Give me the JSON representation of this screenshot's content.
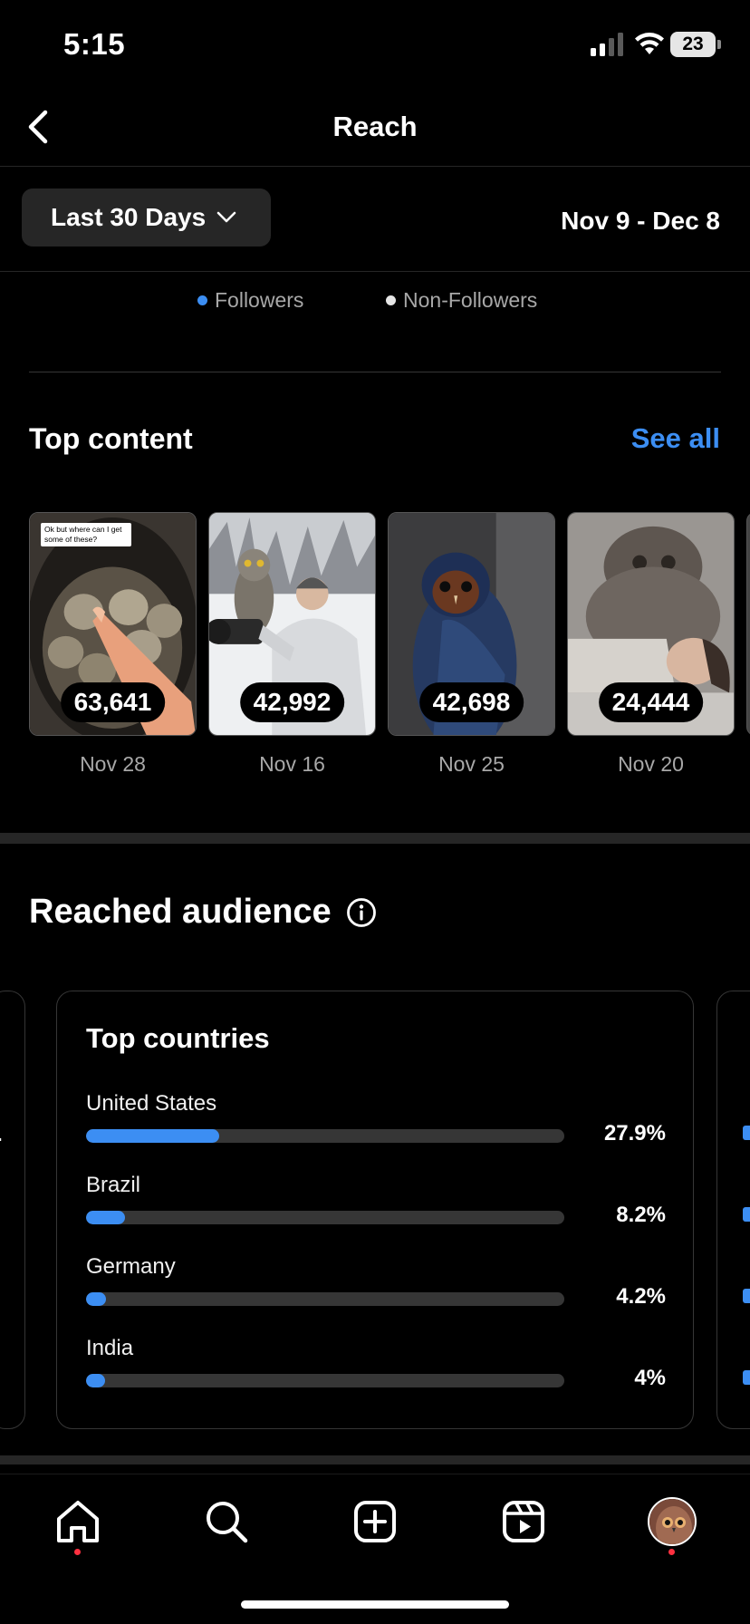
{
  "status_bar": {
    "time": "5:15",
    "battery": "23"
  },
  "header": {
    "title": "Reach",
    "back_icon": "chevron-left-icon"
  },
  "filters": {
    "range_label": "Last 30 Days",
    "date_range": "Nov 9 - Dec 8"
  },
  "legend": {
    "followers": "Followers",
    "non_followers": "Non-Followers",
    "followers_color": "#3c8ef3",
    "non_followers_color": "#e6e6e6"
  },
  "top_content": {
    "title": "Top content",
    "see_all": "See all",
    "items": [
      {
        "count": "63,641",
        "date": "Nov 28",
        "caption": "Ok but where can I get some of these?"
      },
      {
        "count": "42,992",
        "date": "Nov 16"
      },
      {
        "count": "42,698",
        "date": "Nov 25"
      },
      {
        "count": "24,444",
        "date": "Nov 20"
      }
    ]
  },
  "audience": {
    "title": "Reached audience",
    "card_title": "Top countries",
    "countries": [
      {
        "name": "United States",
        "percent": "27.9%",
        "value": 27.9
      },
      {
        "name": "Brazil",
        "percent": "8.2%",
        "value": 8.2
      },
      {
        "name": "Germany",
        "percent": "4.2%",
        "value": 4.2
      },
      {
        "name": "India",
        "percent": "4%",
        "value": 4
      }
    ]
  },
  "tab_bar": {
    "tabs": [
      "home-icon",
      "search-icon",
      "create-icon",
      "reels-icon",
      "profile-avatar"
    ]
  },
  "colors": {
    "accent": "#3c8ef3",
    "background": "#000000",
    "notification": "#ff3040"
  }
}
